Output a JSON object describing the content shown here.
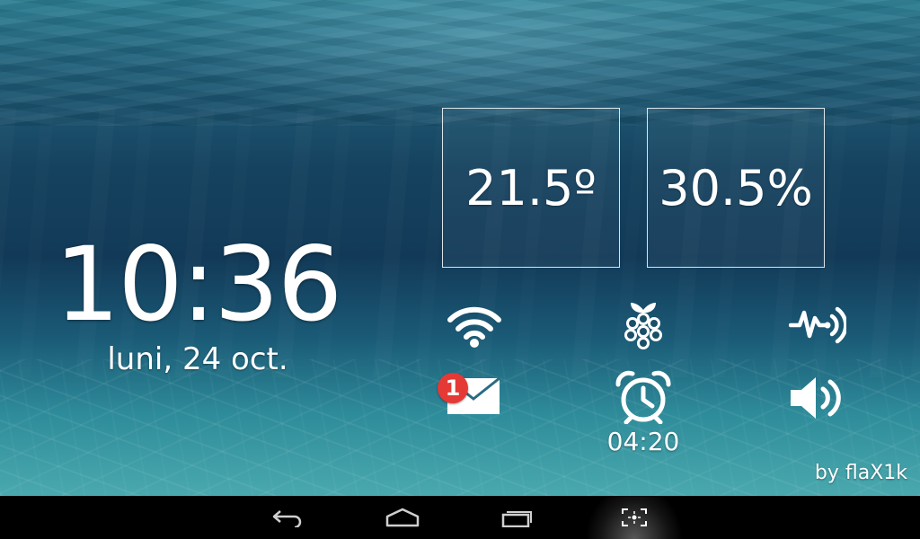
{
  "clock": {
    "time": "10:36",
    "date": "luni, 24 oct."
  },
  "sensors": {
    "temperature": "21.5º",
    "humidity": "30.5%"
  },
  "notifications": {
    "mail_count": "1"
  },
  "alarm": {
    "time": "04:20"
  },
  "credit": "by flaX1k",
  "icons": {
    "wifi": "wifi-icon",
    "raspberry": "raspberry-pi-icon",
    "pulse": "pulse-signal-icon",
    "mail": "mail-icon",
    "alarm": "alarm-clock-icon",
    "volume": "volume-icon"
  },
  "navbar": [
    "back-icon",
    "home-icon",
    "recent-apps-icon",
    "screenshot-icon"
  ],
  "colors": {
    "badge": "#e53935",
    "navbar": "#000000",
    "text": "#ffffff"
  }
}
